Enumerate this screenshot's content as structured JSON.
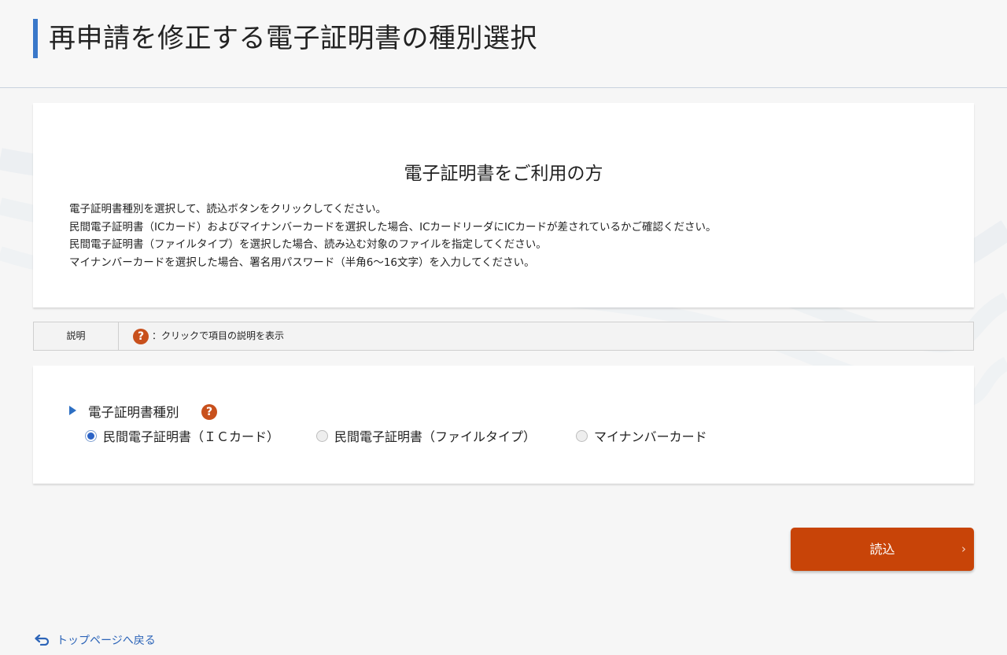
{
  "header": {
    "title": "再申請を修正する電子証明書の種別選択"
  },
  "intro": {
    "heading": "電子証明書をご利用の方",
    "lines": [
      "電子証明書種別を選択して、読込ボタンをクリックしてください。",
      "民間電子証明書（ICカード）およびマイナンバーカードを選択した場合、ICカードリーダにICカードが差されているかご確認ください。",
      "民間電子証明書（ファイルタイプ）を選択した場合、読み込む対象のファイルを指定してください。",
      "マイナンバーカードを選択した場合、署名用パスワード（半角6～16文字）を入力してください。"
    ]
  },
  "legend": {
    "label": "説明",
    "icon_symbol": "?",
    "text": "：クリックで項目の説明を表示"
  },
  "form": {
    "section_label": "電子証明書種別",
    "help_icon_symbol": "?",
    "options": [
      {
        "label": "民間電子証明書（ＩＣカード）",
        "checked": true
      },
      {
        "label": "民間電子証明書（ファイルタイプ）",
        "checked": false
      },
      {
        "label": "マイナンバーカード",
        "checked": false
      }
    ]
  },
  "actions": {
    "read_label": "読込",
    "read_chevron": "›"
  },
  "footer": {
    "back_label": "トップページへ戻る"
  },
  "colors": {
    "accent_blue": "#3a78c9",
    "button_orange": "#c84408",
    "help_icon": "#c8501c",
    "link_blue": "#2c64b8"
  }
}
